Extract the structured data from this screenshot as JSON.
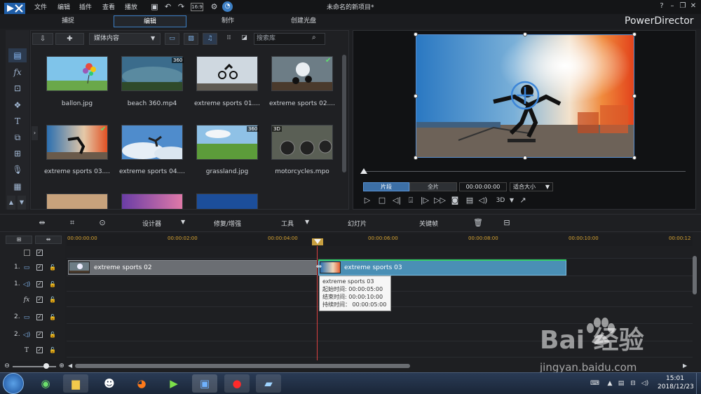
{
  "titlebar": {
    "menus": [
      "文件",
      "编辑",
      "插件",
      "查看",
      "播放"
    ],
    "title": "未命名的新项目*",
    "help": "?"
  },
  "modes": {
    "tabs": [
      "捕捉",
      "编辑",
      "制作",
      "创建光盘"
    ],
    "active": "编辑",
    "brand": "PowerDirector"
  },
  "library": {
    "dropdown": "媒体内容",
    "search_placeholder": "搜索库",
    "items": [
      {
        "label": "ballon.jpg",
        "badge": "",
        "checked": false
      },
      {
        "label": "beach 360.mp4",
        "badge": "360",
        "checked": false
      },
      {
        "label": "extreme sports 01....",
        "badge": "",
        "checked": false
      },
      {
        "label": "extreme sports 02....",
        "badge": "",
        "checked": true
      },
      {
        "label": "extreme sports 03....",
        "badge": "",
        "checked": true
      },
      {
        "label": "extreme sports 04....",
        "badge": "",
        "checked": false
      },
      {
        "label": "grassland.jpg",
        "badge": "360",
        "checked": false
      },
      {
        "label": "motorcycles.mpo",
        "badge": "3D",
        "checked": false
      }
    ]
  },
  "preview": {
    "segment_label": "片段",
    "full_label": "全片",
    "timecode": "00:00:00:00",
    "fit_label": "适合大小",
    "mode_3d": "3D"
  },
  "timeline_toolbar": {
    "designer": "设计器",
    "repair": "修复/增强",
    "tools": "工具",
    "slideshow": "幻灯片",
    "keyframe": "关键帧"
  },
  "ruler": {
    "labels": [
      "00:00:00:00",
      "00:00:02:00",
      "00:00:04:00",
      "00:00:06:00",
      "00:00:08:00",
      "00:00:10:00",
      "00:00:12"
    ]
  },
  "tracks": {
    "video1": "1.",
    "audio1": "1.",
    "video2": "2.",
    "audio2": "2."
  },
  "clips": [
    {
      "name": "extreme sports 02"
    },
    {
      "name": "extreme sports 03"
    }
  ],
  "tooltip": {
    "title": "extreme sports 03",
    "start": "起始时间: 00:00:05:00",
    "end": "结束时间: 00:00:10:00",
    "duration": "持续时间： 00:00:05:00"
  },
  "taskbar": {
    "time": "15:01",
    "date": "2018/12/23"
  },
  "watermark": {
    "logo": "Bai  经验",
    "url": "jingyan.baidu.com"
  }
}
